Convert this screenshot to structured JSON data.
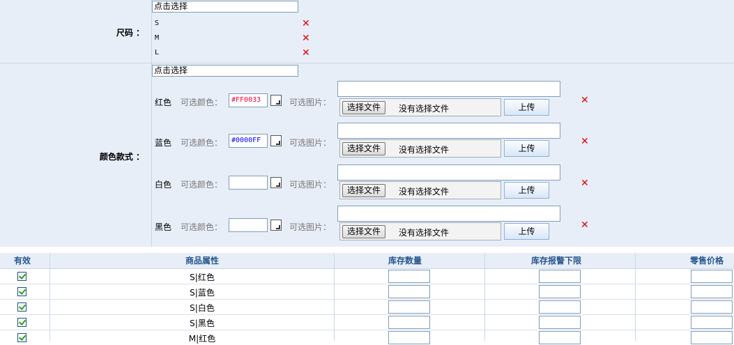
{
  "size_section": {
    "label": "尺码 ：",
    "select_placeholder": "点击选择",
    "items": [
      "S",
      "M",
      "L"
    ]
  },
  "color_section": {
    "label": "颜色款式 ：",
    "select_placeholder": "点击选择",
    "color_label": "可选颜色：",
    "image_label": "可选图片：",
    "file_button": "选择文件",
    "no_file_text": "没有选择文件",
    "upload_button": "上传",
    "items": [
      {
        "name": "红色",
        "hex": "#FF0033",
        "hex_text_color": "#ff0033"
      },
      {
        "name": "蓝色",
        "hex": "#0000FF",
        "hex_text_color": "#0000ff"
      },
      {
        "name": "白色",
        "hex": "",
        "hex_text_color": "#000000"
      },
      {
        "name": "黑色",
        "hex": "",
        "hex_text_color": "#000000"
      }
    ]
  },
  "grid": {
    "headers": {
      "valid": "有效",
      "attribute": "商品属性",
      "stock": "库存数量",
      "stock_alert": "库存报警下限",
      "price": "零售价格"
    },
    "rows": [
      {
        "attribute": "S|红色",
        "checked": true
      },
      {
        "attribute": "S|蓝色",
        "checked": true
      },
      {
        "attribute": "S|白色",
        "checked": true
      },
      {
        "attribute": "S|黑色",
        "checked": true
      },
      {
        "attribute": "M|红色",
        "checked": true
      }
    ]
  },
  "colors": {
    "panel_bg": "#e8eef7",
    "header_text": "#26568f",
    "delete_red": "#e00000"
  }
}
